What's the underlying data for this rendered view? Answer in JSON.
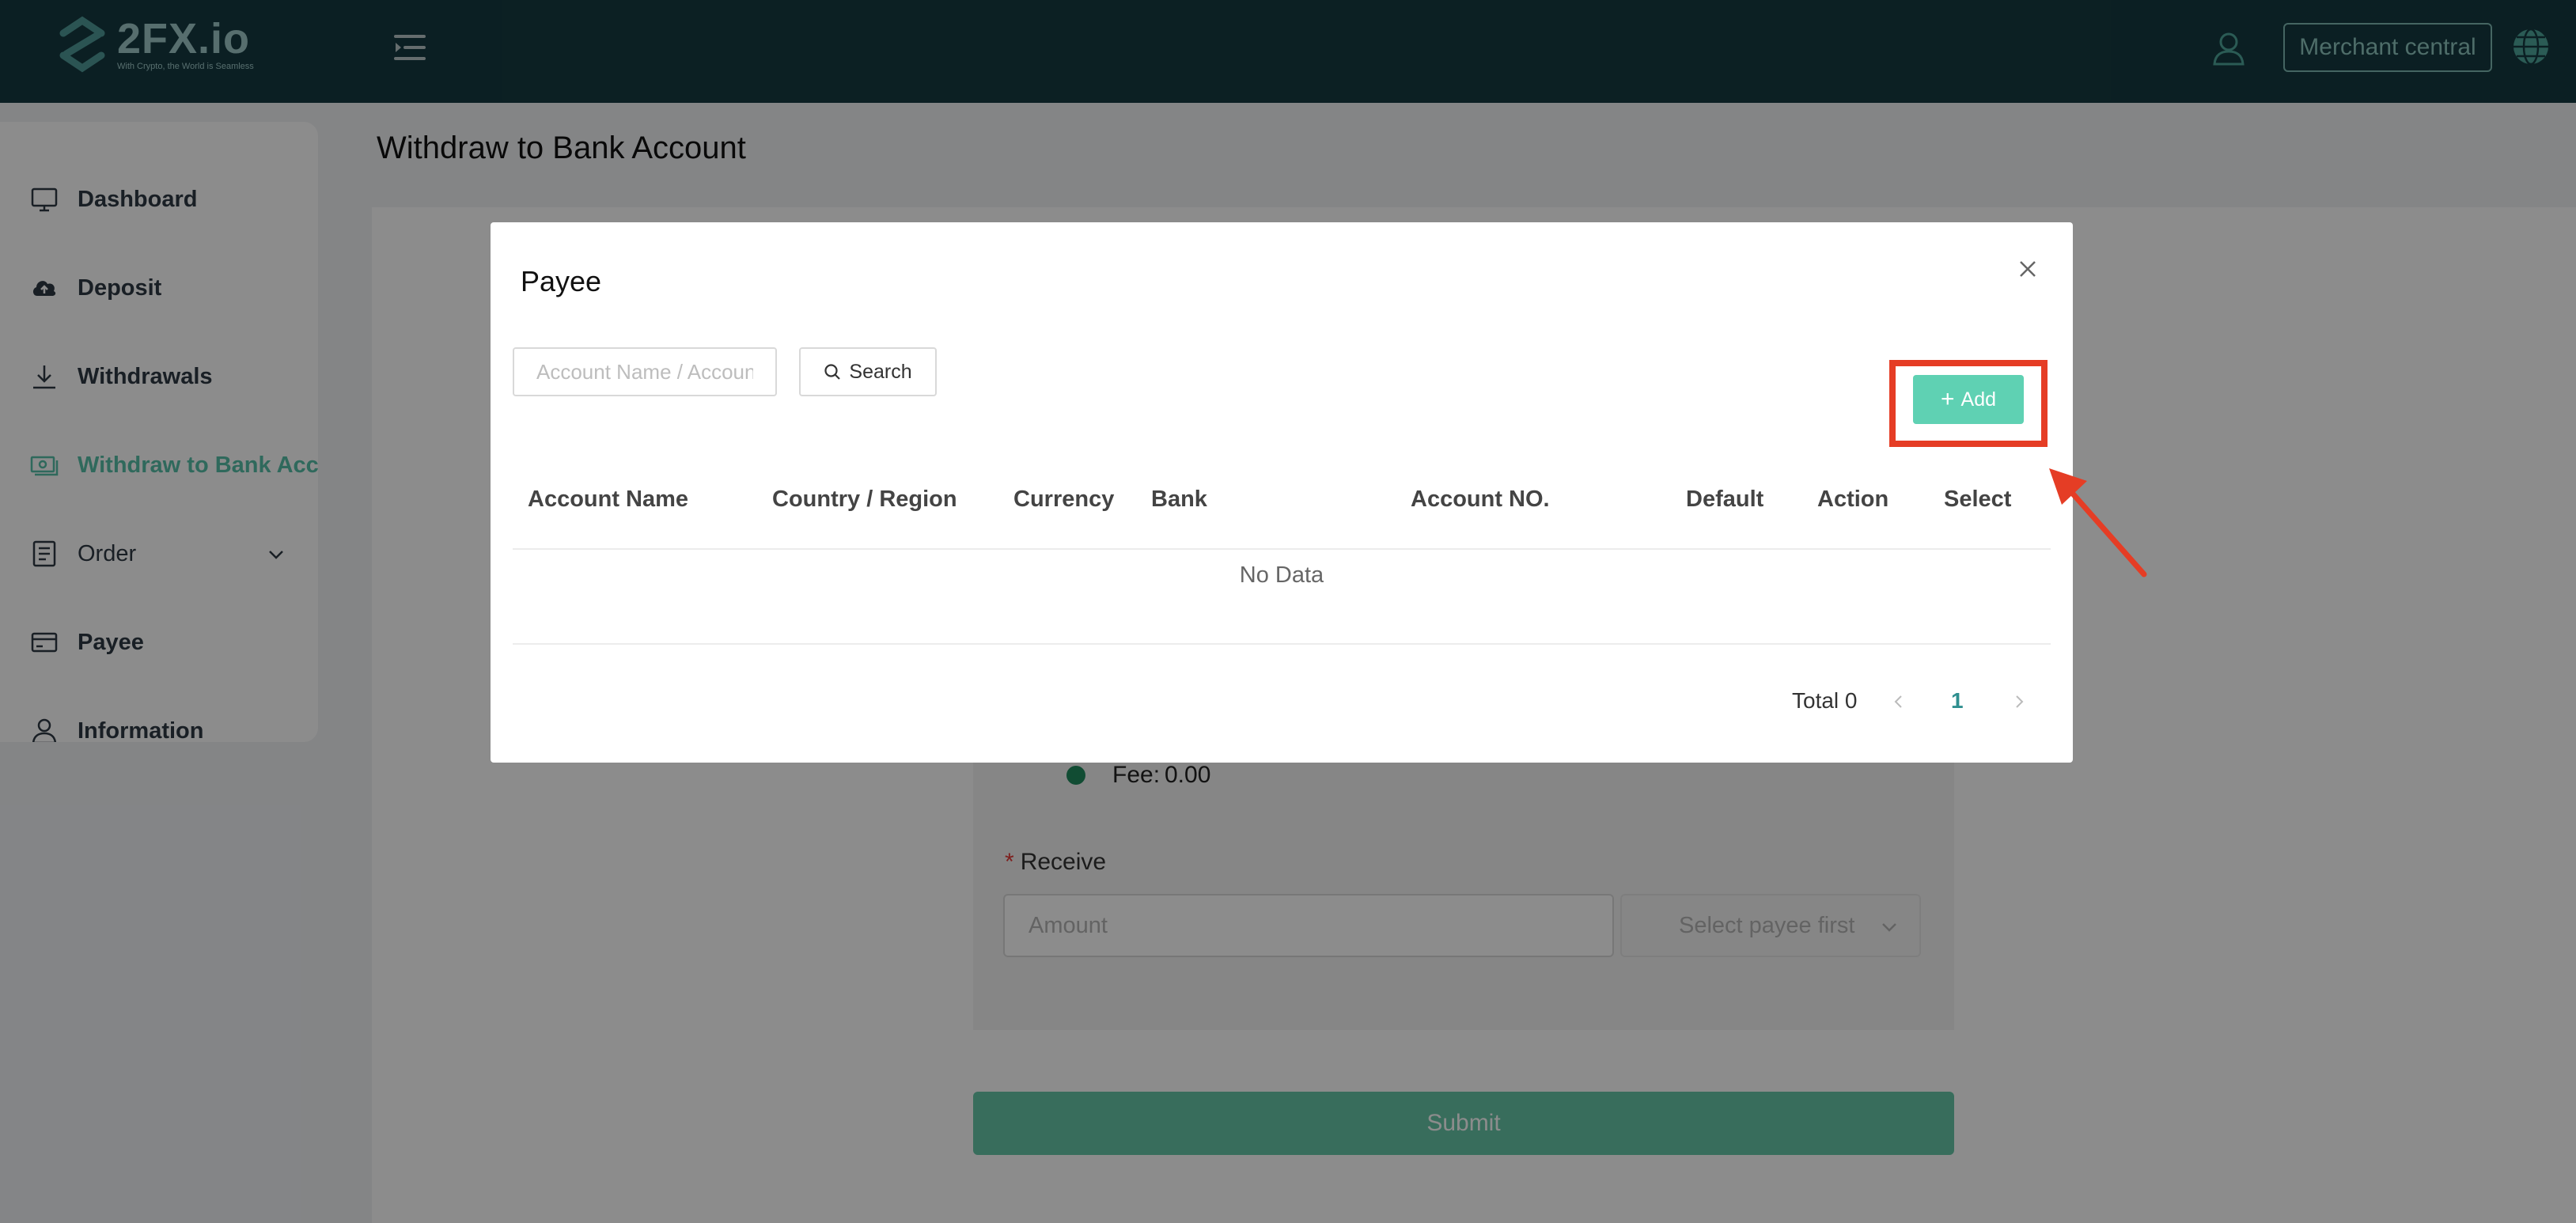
{
  "header": {
    "logo_text": "2FX.io",
    "logo_tagline": "With Crypto, the World is Seamless",
    "merchant_button": "Merchant central",
    "icons": [
      "logo-mark",
      "menu-toggle-icon",
      "user-icon",
      "globe-icon"
    ]
  },
  "sidebar": {
    "items": [
      {
        "label": "Dashboard",
        "icon": "monitor-icon"
      },
      {
        "label": "Deposit",
        "icon": "cloud-upload-icon"
      },
      {
        "label": "Withdrawals",
        "icon": "download-icon"
      },
      {
        "label": "Withdraw to Bank Account",
        "icon": "money-icon",
        "active": true
      },
      {
        "label": "Order",
        "icon": "document-icon",
        "expandable": true
      },
      {
        "label": "Payee",
        "icon": "credit-card-icon"
      },
      {
        "label": "Information",
        "icon": "user-icon"
      }
    ]
  },
  "page": {
    "title": "Withdraw to Bank Account",
    "fee_label": "Fee:",
    "fee_value": "0.00",
    "receive_label": "Receive",
    "amount_placeholder": "Amount",
    "payee_select_placeholder": "Select payee first",
    "submit_label": "Submit"
  },
  "modal": {
    "title": "Payee",
    "search_placeholder": "Account Name / Account NO.",
    "search_button": "Search",
    "add_button": "Add",
    "columns": [
      "Account Name",
      "Country / Region",
      "Currency",
      "Bank",
      "Account NO.",
      "Default",
      "Action",
      "Select"
    ],
    "empty_text": "No Data",
    "pagination": {
      "total_label": "Total 0",
      "current_page": "1"
    }
  },
  "colors": {
    "header_bg": "#153a40",
    "accent": "#57bfa8",
    "add_button": "#5fd1b3",
    "highlight": "#e53d25"
  }
}
